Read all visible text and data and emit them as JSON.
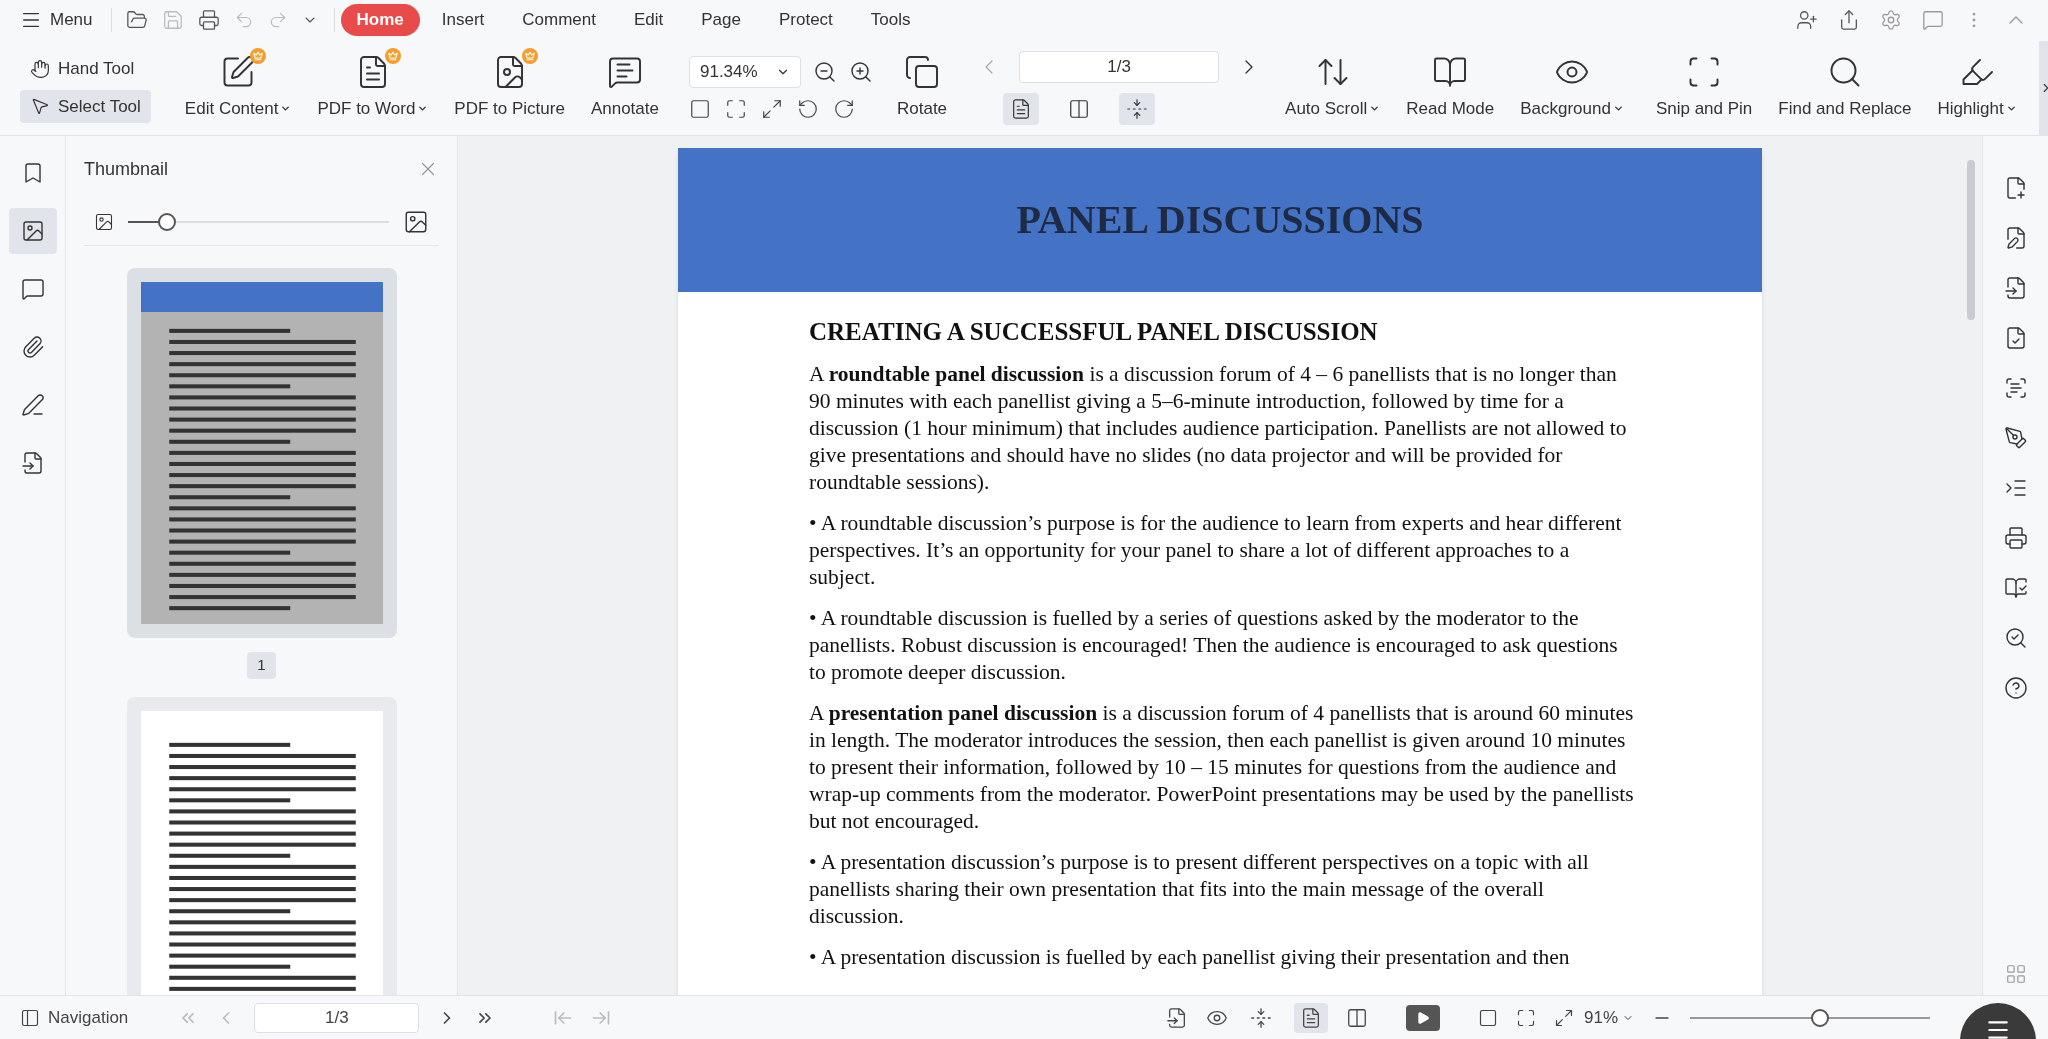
{
  "menu_bar": {
    "menu_label": "Menu",
    "tabs": [
      {
        "label": "Home",
        "selected": true
      },
      {
        "label": "Insert",
        "selected": false
      },
      {
        "label": "Comment",
        "selected": false
      },
      {
        "label": "Edit",
        "selected": false
      },
      {
        "label": "Page",
        "selected": false
      },
      {
        "label": "Protect",
        "selected": false
      },
      {
        "label": "Tools",
        "selected": false
      }
    ]
  },
  "toolbar": {
    "modes": [
      {
        "kind": "hand",
        "label": "Hand Tool",
        "selected": false
      },
      {
        "kind": "select",
        "label": "Select Tool",
        "selected": true
      }
    ],
    "groups": [
      [
        {
          "kind": "edit",
          "label": "Edit Content",
          "dropdown": true,
          "premium": true
        },
        {
          "kind": "word",
          "label": "PDF to Word",
          "dropdown": true,
          "premium": true
        },
        {
          "kind": "picture",
          "label": "PDF to Picture",
          "dropdown": false,
          "premium": true
        },
        {
          "kind": "annotate",
          "label": "Annotate",
          "dropdown": false,
          "premium": false
        }
      ],
      [
        {
          "kind": "rotate",
          "label": "Rotate",
          "dropdown": false,
          "premium": false
        }
      ],
      [
        {
          "kind": "autoscroll",
          "label": "Auto Scroll",
          "dropdown": true,
          "premium": false
        },
        {
          "kind": "read",
          "label": "Read Mode",
          "dropdown": false,
          "premium": false
        },
        {
          "kind": "background",
          "label": "Background",
          "dropdown": true,
          "premium": false
        }
      ],
      [
        {
          "kind": "snip",
          "label": "Snip and Pin",
          "dropdown": false,
          "premium": false
        },
        {
          "kind": "find",
          "label": "Find and Replace",
          "dropdown": false,
          "premium": false
        },
        {
          "kind": "highlight",
          "label": "Highlight",
          "dropdown": true,
          "premium": false
        }
      ]
    ],
    "zoom": {
      "value": "91.34%"
    },
    "page": {
      "value": "1/3"
    },
    "view_modes": [
      {
        "kind": "single",
        "selected": true
      },
      {
        "kind": "double",
        "selected": false
      },
      {
        "kind": "continuous",
        "selected": true
      }
    ]
  },
  "sidebar": {
    "items": [
      {
        "kind": "bookmark",
        "selected": false
      },
      {
        "kind": "thumbnail",
        "selected": true
      },
      {
        "kind": "comment",
        "selected": false
      },
      {
        "kind": "attachment",
        "selected": false
      },
      {
        "kind": "signature",
        "selected": false
      },
      {
        "kind": "convert",
        "selected": false
      }
    ]
  },
  "thumbnail_panel": {
    "title": "Thumbnail",
    "size_slider": {
      "level": 0.15
    },
    "pages": [
      {
        "label": "1",
        "selected": true
      },
      {
        "selected": false
      }
    ]
  },
  "document": {
    "banner_title": "PANEL DISCUSSIONS",
    "heading": "CREATING A SUCCESSFUL PANEL DISCUSSION",
    "paragraphs": [
      "A **roundtable panel discussion** is a discussion forum of 4 – 6 panellists that is no longer than 90 minutes with each panellist giving a 5–6-minute introduction, followed by time for a discussion (1 hour minimum) that includes audience participation. Panellists are not allowed to give presentations and should have no slides (no data projector and will be provided for roundtable sessions).",
      "• A roundtable discussion’s purpose is for the audience to learn from experts and hear different perspectives. It’s an opportunity for your panel to share a lot of different approaches to a subject.",
      "• A roundtable discussion is fuelled by a series of questions asked by the moderator to the panellists. Robust discussion is encouraged! Then the audience is encouraged to ask questions to promote deeper discussion.",
      "A **presentation panel discussion** is a discussion forum of 4 panellists that is around 60 minutes in length. The moderator introduces the session, then each panellist is given around 10 minutes to present their information, followed by 10 – 15 minutes for questions from the audience and wrap-up comments from the moderator. PowerPoint presentations may be used by the panellists but not encouraged.",
      "• A presentation discussion’s purpose is to present different perspectives on a topic with all panellists sharing their own presentation that fits into the main message of the overall discussion.",
      "• A presentation discussion is fuelled by each panellist giving their presentation and then"
    ]
  },
  "status_bar": {
    "navigation_label": "Navigation",
    "page": {
      "value": "1/3"
    },
    "zoom_label": "91%",
    "zoom_slider": {
      "level": 0.54
    }
  }
}
